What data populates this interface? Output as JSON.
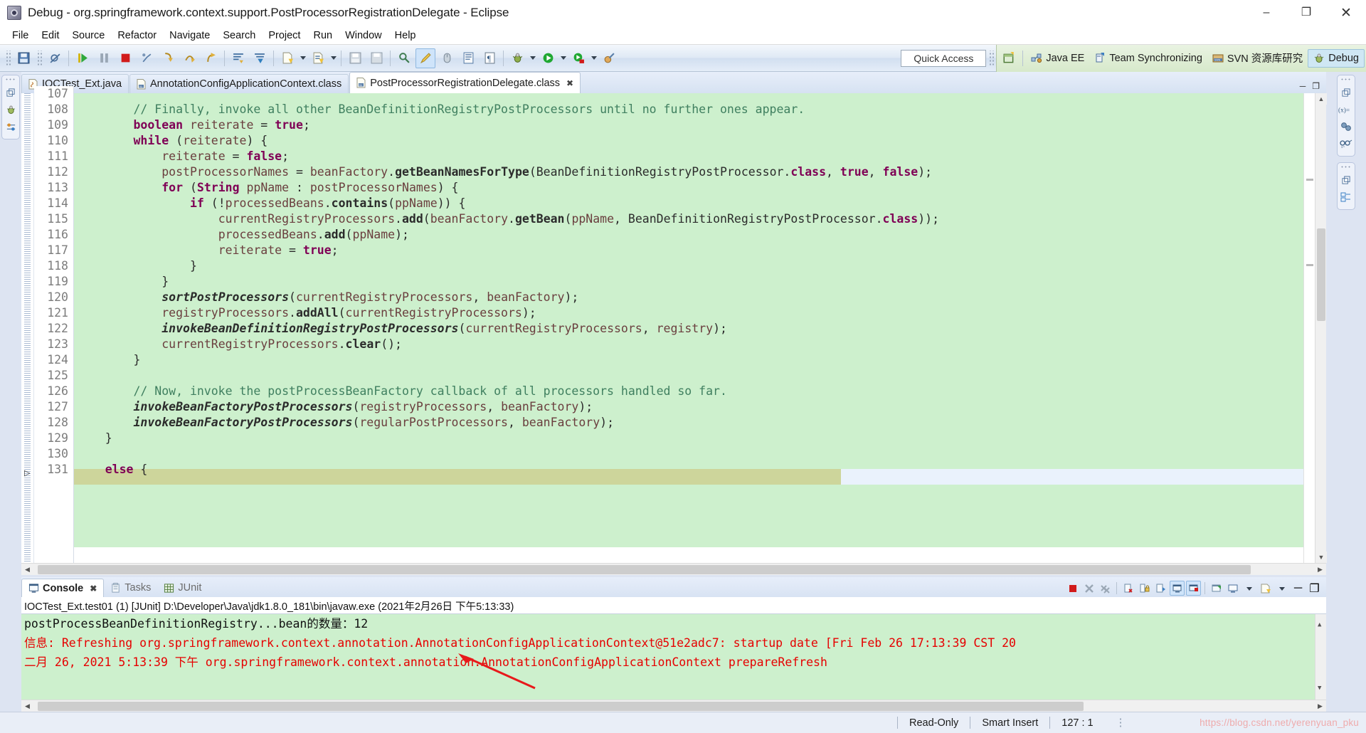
{
  "window": {
    "title": "Debug - org.springframework.context.support.PostProcessorRegistrationDelegate - Eclipse",
    "minimize": "–",
    "maximize": "❐",
    "close": "✕"
  },
  "menubar": {
    "items": [
      "File",
      "Edit",
      "Source",
      "Refactor",
      "Navigate",
      "Search",
      "Project",
      "Run",
      "Window",
      "Help"
    ]
  },
  "toolbar": {
    "quick_access_placeholder": "Quick Access",
    "icon_names": [
      "save-icon",
      "skip-breakpoints-icon",
      "resume-icon",
      "suspend-icon",
      "terminate-icon",
      "disconnect-icon",
      "step-into-icon",
      "step-over-icon",
      "step-return-icon",
      "collapse-all-icon",
      "expand-frames-icon",
      "new-icon",
      "new-class-icon",
      "save-all-icon",
      "print-icon",
      "search-icon",
      "marker-icon",
      "mouse-icon",
      "console-view-icon",
      "paragraph-icon",
      "debug-icon",
      "run-icon",
      "run-coverage-icon",
      "external-tools-icon"
    ]
  },
  "perspectives": {
    "open_label": "open-perspective-icon",
    "items": [
      {
        "label": "Java EE",
        "icon": "javaee-perspective-icon",
        "active": false
      },
      {
        "label": "Team Synchronizing",
        "icon": "team-sync-icon",
        "active": false
      },
      {
        "label": "SVN 资源库研究",
        "icon": "svn-repo-icon",
        "active": false
      },
      {
        "label": "Debug",
        "icon": "debug-perspective-icon",
        "active": true
      }
    ]
  },
  "left_rail": {
    "icons": [
      "restore-icon",
      "debug-view-icon",
      "breakpoints-view-icon"
    ]
  },
  "right_rail": {
    "group_one": [
      "restore-icon",
      "variables-view-icon",
      "breakpoints-dot-icon",
      "expressions-view-icon"
    ],
    "group_two": [
      "restore-icon",
      "outline-view-icon"
    ]
  },
  "editor": {
    "tabs": [
      {
        "label": "IOCTest_Ext.java",
        "icon": "java-file-icon",
        "active": false,
        "closable": false
      },
      {
        "label": "AnnotationConfigApplicationContext.class",
        "icon": "class-file-icon",
        "active": false,
        "closable": false
      },
      {
        "label": "PostProcessorRegistrationDelegate.class",
        "icon": "class-file-icon",
        "active": true,
        "closable": true
      }
    ],
    "tab_close_glyph": "✖",
    "minimize_glyph": "─",
    "maximize_glyph": "❐",
    "first_visible_line": 107,
    "current_debug_line": 127,
    "lines": [
      {
        "n": 107,
        "text": ""
      },
      {
        "n": 108,
        "text": "        // Finally, invoke all other BeanDefinitionRegistryPostProcessors until no further ones appear."
      },
      {
        "n": 109,
        "text": "        boolean reiterate = true;"
      },
      {
        "n": 110,
        "text": "        while (reiterate) {"
      },
      {
        "n": 111,
        "text": "            reiterate = false;"
      },
      {
        "n": 112,
        "text": "            postProcessorNames = beanFactory.getBeanNamesForType(BeanDefinitionRegistryPostProcessor.class, true, false);"
      },
      {
        "n": 113,
        "text": "            for (String ppName : postProcessorNames) {"
      },
      {
        "n": 114,
        "text": "                if (!processedBeans.contains(ppName)) {"
      },
      {
        "n": 115,
        "text": "                    currentRegistryProcessors.add(beanFactory.getBean(ppName, BeanDefinitionRegistryPostProcessor.class));"
      },
      {
        "n": 116,
        "text": "                    processedBeans.add(ppName);"
      },
      {
        "n": 117,
        "text": "                    reiterate = true;"
      },
      {
        "n": 118,
        "text": "                }"
      },
      {
        "n": 119,
        "text": "            }"
      },
      {
        "n": 120,
        "text": "            sortPostProcessors(currentRegistryProcessors, beanFactory);"
      },
      {
        "n": 121,
        "text": "            registryProcessors.addAll(currentRegistryProcessors);"
      },
      {
        "n": 122,
        "text": "            invokeBeanDefinitionRegistryPostProcessors(currentRegistryProcessors, registry);"
      },
      {
        "n": 123,
        "text": "            currentRegistryProcessors.clear();"
      },
      {
        "n": 124,
        "text": "        }"
      },
      {
        "n": 125,
        "text": ""
      },
      {
        "n": 126,
        "text": "        // Now, invoke the postProcessBeanFactory callback of all processors handled so far."
      },
      {
        "n": 127,
        "text": "        invokeBeanFactoryPostProcessors(registryProcessors, beanFactory);"
      },
      {
        "n": 128,
        "text": "        invokeBeanFactoryPostProcessors(regularPostProcessors, beanFactory);"
      },
      {
        "n": 129,
        "text": "    }"
      },
      {
        "n": 130,
        "text": ""
      },
      {
        "n": 131,
        "text": "    else {"
      }
    ]
  },
  "console": {
    "tabs": [
      {
        "label": "Console",
        "icon": "console-icon",
        "active": true,
        "closable": true
      },
      {
        "label": "Tasks",
        "icon": "tasks-icon",
        "active": false,
        "closable": false
      },
      {
        "label": "JUnit",
        "icon": "junit-icon",
        "active": false,
        "closable": false
      }
    ],
    "tab_close_glyph": "✖",
    "launch_line": "IOCTest_Ext.test01 (1) [JUnit] D:\\Developer\\Java\\jdk1.8.0_181\\bin\\javaw.exe (2021年2月26日 下午5:13:33)",
    "toolbar_icons": [
      "terminate-icon",
      "remove-launch-icon",
      "remove-all-terminated-icon",
      "clear-console-icon",
      "scroll-lock-icon",
      "show-when-stdout-icon",
      "pin-console-icon",
      "display-selected-console-icon",
      "open-console-icon",
      "new-console-view-icon",
      "minimize-icon",
      "maximize-icon"
    ],
    "minimize_glyph": "─",
    "maximize_glyph": "❐",
    "output": [
      {
        "text": "二月 26, 2021 5:13:39 下午 org.springframework.context.annotation.AnnotationConfigApplicationContext prepareRefresh",
        "color": "red"
      },
      {
        "text": "信息: Refreshing org.springframework.context.annotation.AnnotationConfigApplicationContext@51e2adc7: startup date [Fri Feb 26 17:13:39 CST 20",
        "color": "red"
      },
      {
        "text": "postProcessBeanDefinitionRegistry...bean的数量：12",
        "color": "black"
      }
    ]
  },
  "statusbar": {
    "read_only": "Read-Only",
    "insert_mode": "Smart Insert",
    "cursor_position": "127 : 1",
    "watermark": "https://blog.csdn.net/yerenyuan_pku"
  },
  "colors": {
    "code_highlight_green": "#cdf0cd",
    "current_line_olive": "#cdd59b",
    "selection_blue": "#eaf2fc",
    "console_red": "#e60000",
    "keyword_purple": "#7f0055",
    "comment_green": "#3f7f5f",
    "field_brown": "#6a3e3e",
    "perspective_bar_green": "#dfeed3",
    "annotation_red": "#e8191b"
  }
}
